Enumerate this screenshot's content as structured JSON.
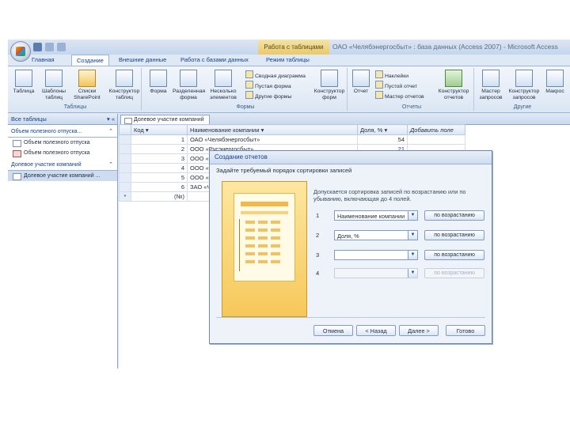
{
  "title": {
    "context_tab": "Работа с таблицами",
    "text": "ОАО «Челябэнергосбыт» : база данных (Access 2007) - Microsoft Access"
  },
  "ribbon_tabs": [
    "Главная",
    "Создание",
    "Внешние данные",
    "Работа с базами данных",
    "Режим таблицы"
  ],
  "ribbon": {
    "tables": {
      "label": "Таблицы",
      "buttons": [
        "Таблица",
        "Шаблоны таблиц",
        "Списки SharePoint",
        "Конструктор таблиц"
      ]
    },
    "forms": {
      "label": "Формы",
      "big": [
        "Форма",
        "Разделенная форма",
        "Несколько элементов"
      ],
      "small": [
        "Сводная диаграмма",
        "Пустая форма",
        "Другие формы"
      ],
      "designer": "Конструктор форм"
    },
    "reports": {
      "label": "Отчеты",
      "big": [
        "Отчет"
      ],
      "small": [
        "Наклейки",
        "Пустой отчет",
        "Мастер отчетов"
      ],
      "designer": "Конструктор отчетов"
    },
    "other": {
      "label": "Другие",
      "buttons": [
        "Мастер запросов",
        "Конструктор запросов",
        "Макрос"
      ]
    }
  },
  "navpane": {
    "header": "Все таблицы",
    "groups": [
      {
        "title": "Объем полезного отпуска...",
        "items": [
          {
            "label": "Объем полезного отпуска",
            "type": "table"
          },
          {
            "label": "Объем полезного отпуска",
            "type": "form"
          }
        ]
      },
      {
        "title": "Долевое участие компаний",
        "items": [
          {
            "label": "Долевое участие компаний ...",
            "type": "table"
          }
        ]
      }
    ]
  },
  "document": {
    "tab": "Долевое участие компаний",
    "columns": [
      "Код",
      "Наименование компании",
      "Доля, %",
      "Добавить поле"
    ],
    "rows": [
      {
        "code": "1",
        "name": "ОАО «Челябэнергосбыт»",
        "share": "54"
      },
      {
        "code": "2",
        "name": "ООО «Русэнергосбыт»",
        "share": "21"
      },
      {
        "code": "3",
        "name": "ООО «МС»",
        "share": ""
      },
      {
        "code": "4",
        "name": "ООО «Рус»",
        "share": ""
      },
      {
        "code": "5",
        "name": "ООО «Мо»",
        "share": ""
      },
      {
        "code": "6",
        "name": "ЗАО «Ч»",
        "share": ""
      }
    ],
    "new_row": {
      "marker": "*",
      "code": "(№)"
    }
  },
  "dialog": {
    "title": "Создание отчетов",
    "prompt": "Задайте требуемый порядок сортировки записей",
    "description": "Допускается сортировка записей по возрастанию или по убыванию, включающая до 4 полей.",
    "sorts": [
      {
        "num": "1",
        "value": "Наименование компании",
        "order": "по возрастанию",
        "enabled": true
      },
      {
        "num": "2",
        "value": "Доля, %",
        "order": "по возрастанию",
        "enabled": true
      },
      {
        "num": "3",
        "value": "",
        "order": "по возрастанию",
        "enabled": true
      },
      {
        "num": "4",
        "value": "",
        "order": "по возрастанию",
        "enabled": false
      }
    ],
    "buttons": {
      "cancel": "Отмена",
      "back": "< Назад",
      "next": "Далее >",
      "finish": "Готово"
    }
  }
}
